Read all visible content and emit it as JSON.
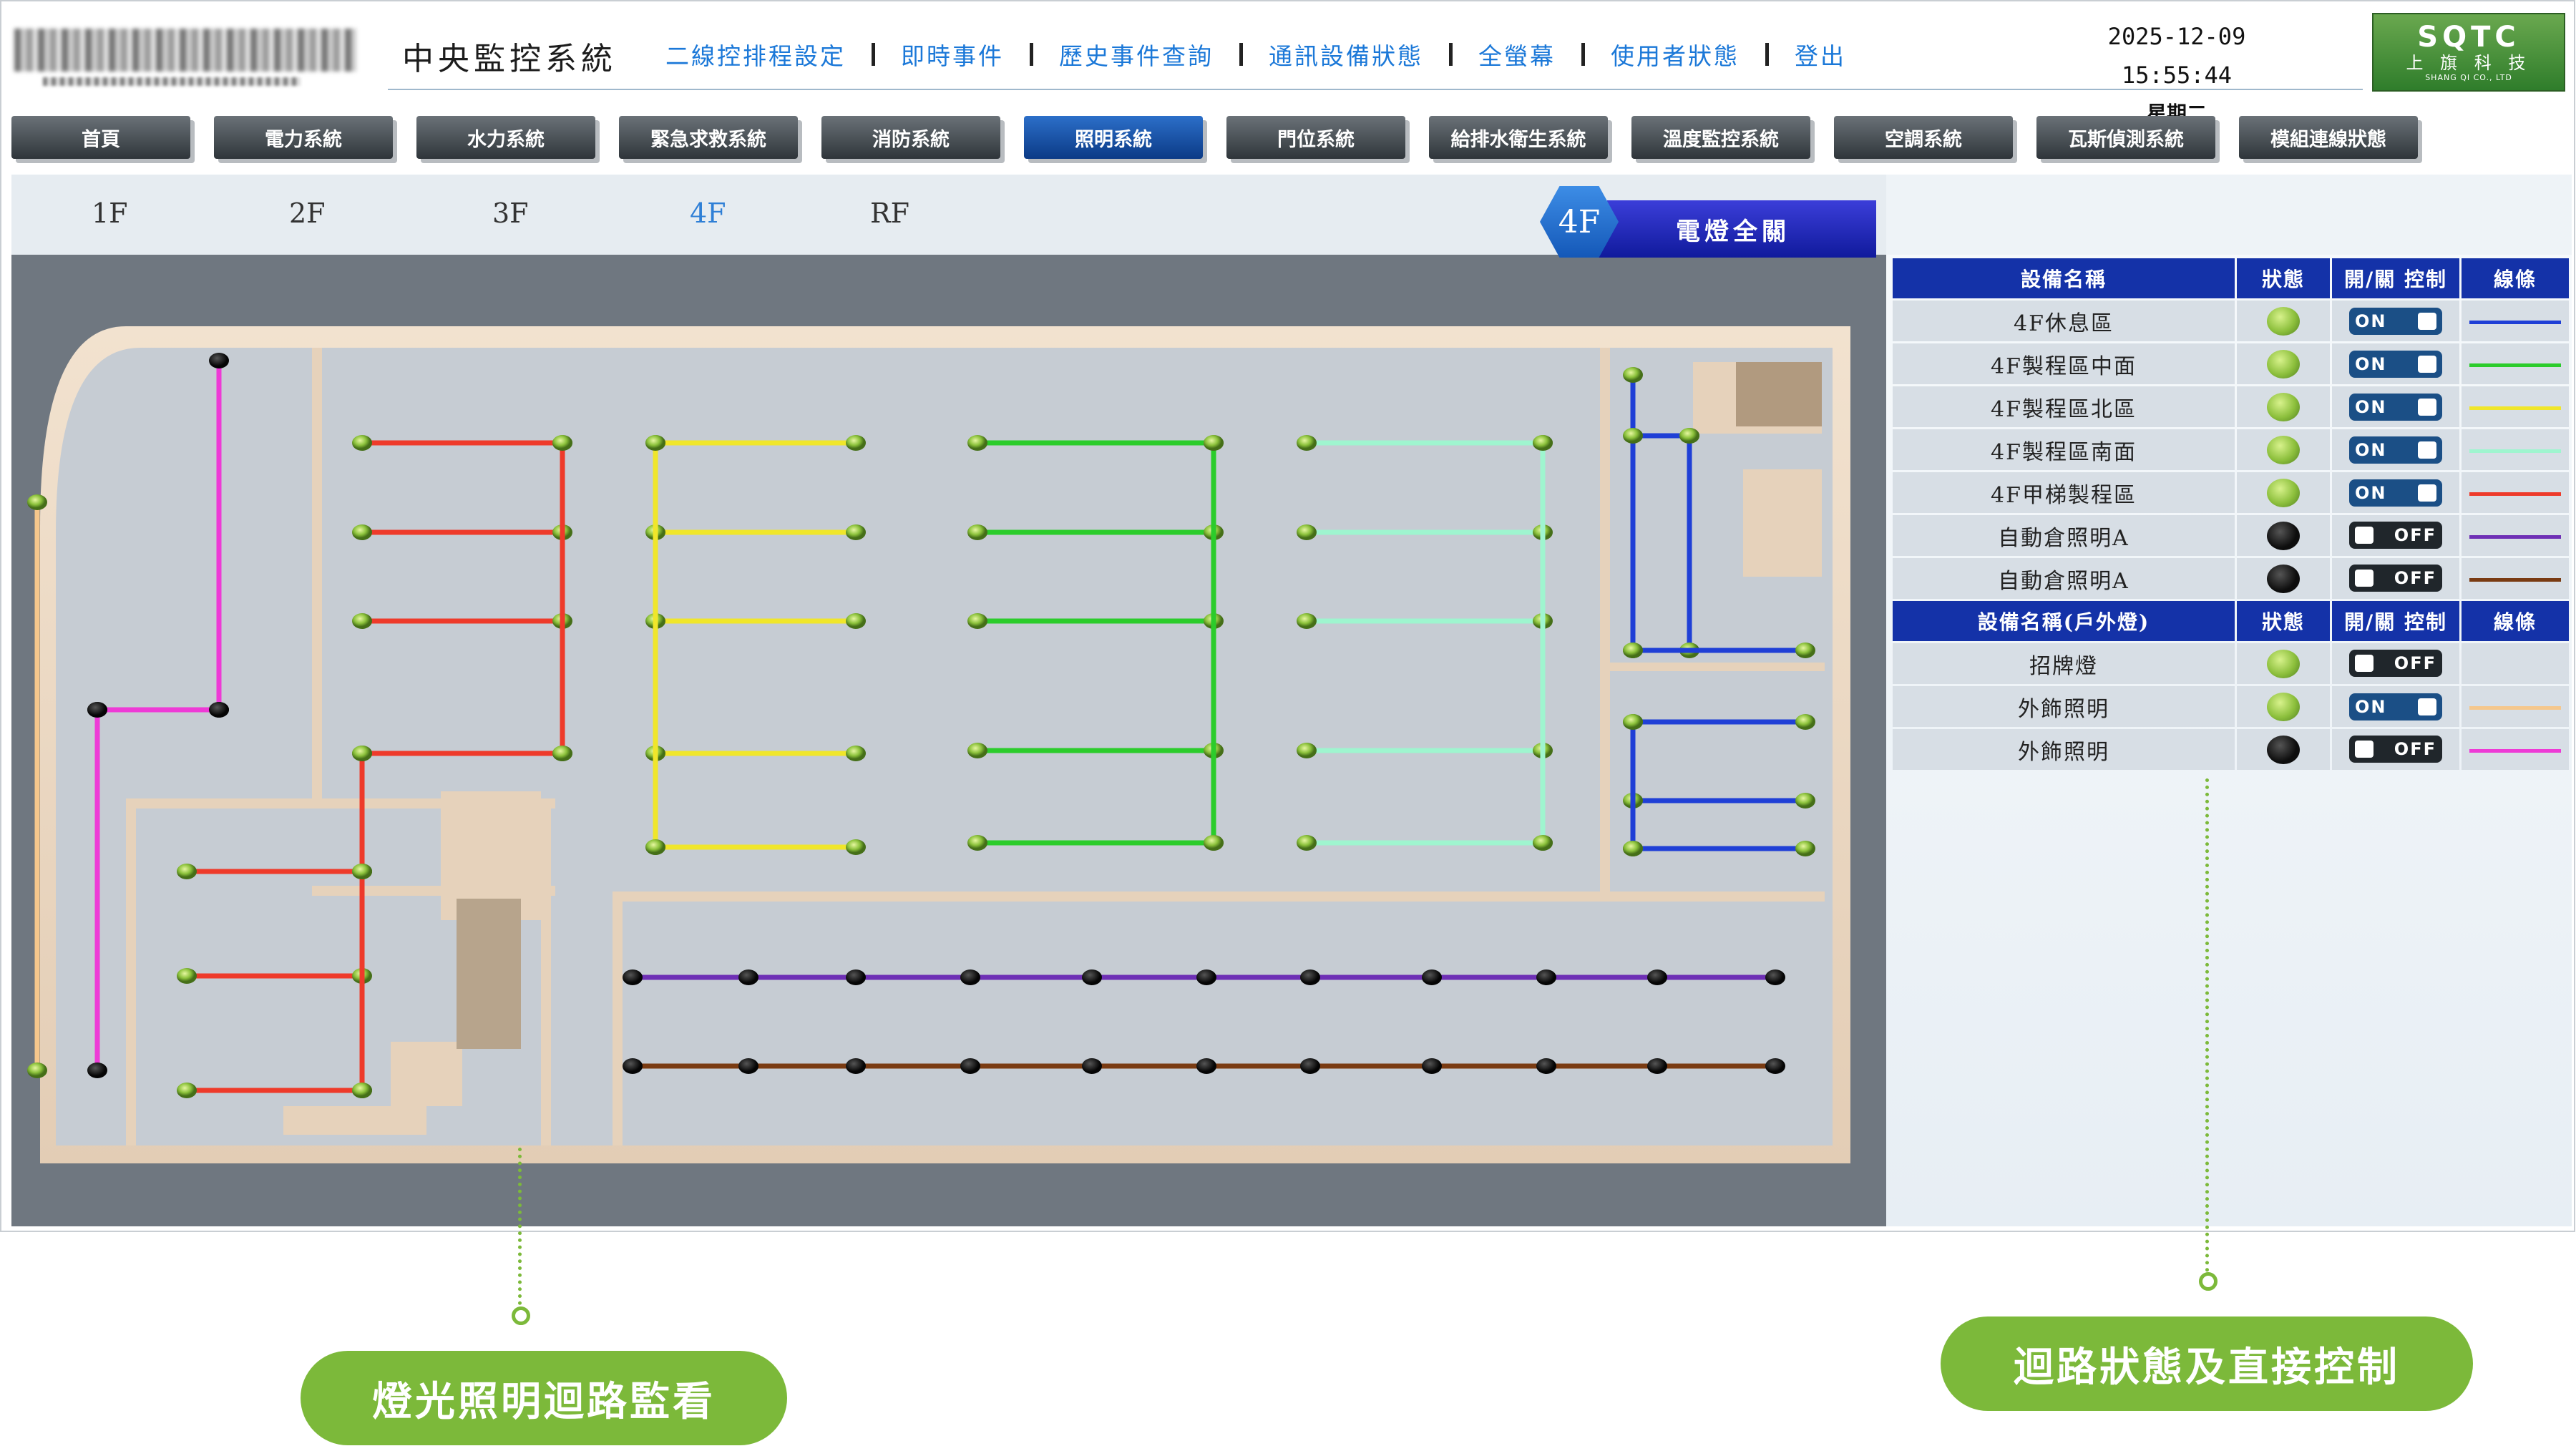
{
  "header": {
    "logo_name": "SQTC",
    "system_title": "中央監控系統",
    "nav": [
      "二線控排程設定",
      "即時事件",
      "歷史事件查詢",
      "通訊設備狀態",
      "全螢幕",
      "使用者狀態",
      "登出"
    ],
    "datetime": "2025-12-09 15:55:44",
    "weekday": "星期二",
    "brand": {
      "name": "SQTC",
      "cn": "上 旗 科 技",
      "en": "SHANG QI CO., LTD"
    }
  },
  "tabs": [
    {
      "label": "首頁",
      "active": false
    },
    {
      "label": "電力系統",
      "active": false
    },
    {
      "label": "水力系統",
      "active": false
    },
    {
      "label": "緊急求救系統",
      "active": false
    },
    {
      "label": "消防系統",
      "active": false
    },
    {
      "label": "照明系統",
      "active": true
    },
    {
      "label": "門位系統",
      "active": false
    },
    {
      "label": "給排水衛生系統",
      "active": false
    },
    {
      "label": "溫度監控系統",
      "active": false
    },
    {
      "label": "空調系統",
      "active": false
    },
    {
      "label": "瓦斯偵測系統",
      "active": false
    },
    {
      "label": "模組連線狀態",
      "active": false
    }
  ],
  "floors": [
    {
      "label": "1F",
      "active": false
    },
    {
      "label": "2F",
      "active": false
    },
    {
      "label": "3F",
      "active": false
    },
    {
      "label": "4F",
      "active": true
    },
    {
      "label": "RF",
      "active": false
    }
  ],
  "floor_badge": {
    "floor": "4F",
    "action": "電燈全關"
  },
  "indoor_table": {
    "headers": [
      "設備名稱",
      "狀態",
      "開/關 控制",
      "線條"
    ],
    "rows": [
      {
        "name": "4F休息區",
        "status": "on",
        "control": "ON",
        "line_color": "#1f3fd6"
      },
      {
        "name": "4F製程區中面",
        "status": "on",
        "control": "ON",
        "line_color": "#2bcc2b"
      },
      {
        "name": "4F製程區北區",
        "status": "on",
        "control": "ON",
        "line_color": "#f0e62a"
      },
      {
        "name": "4F製程區南面",
        "status": "on",
        "control": "ON",
        "line_color": "#9ff5cf"
      },
      {
        "name": "4F甲梯製程區",
        "status": "on",
        "control": "ON",
        "line_color": "#ee3a2a"
      },
      {
        "name": "自動倉照明A",
        "status": "off",
        "control": "OFF",
        "line_color": "#6e2fb5"
      },
      {
        "name": "自動倉照明A",
        "status": "off",
        "control": "OFF",
        "line_color": "#7a3b12"
      }
    ]
  },
  "outdoor_table": {
    "headers": [
      "設備名稱(戶外燈)",
      "狀態",
      "開/關 控制",
      "線條"
    ],
    "rows": [
      {
        "name": "招牌燈",
        "status": "on",
        "control": "OFF",
        "line_color": ""
      },
      {
        "name": "外飾照明",
        "status": "on",
        "control": "ON",
        "line_color": "#f5c78c"
      },
      {
        "name": "外飾照明",
        "status": "off",
        "control": "OFF",
        "line_color": "#ee3ad6"
      }
    ]
  },
  "callouts": {
    "left": "燈光照明迴路監看",
    "right": "迴路狀態及直接控制"
  }
}
